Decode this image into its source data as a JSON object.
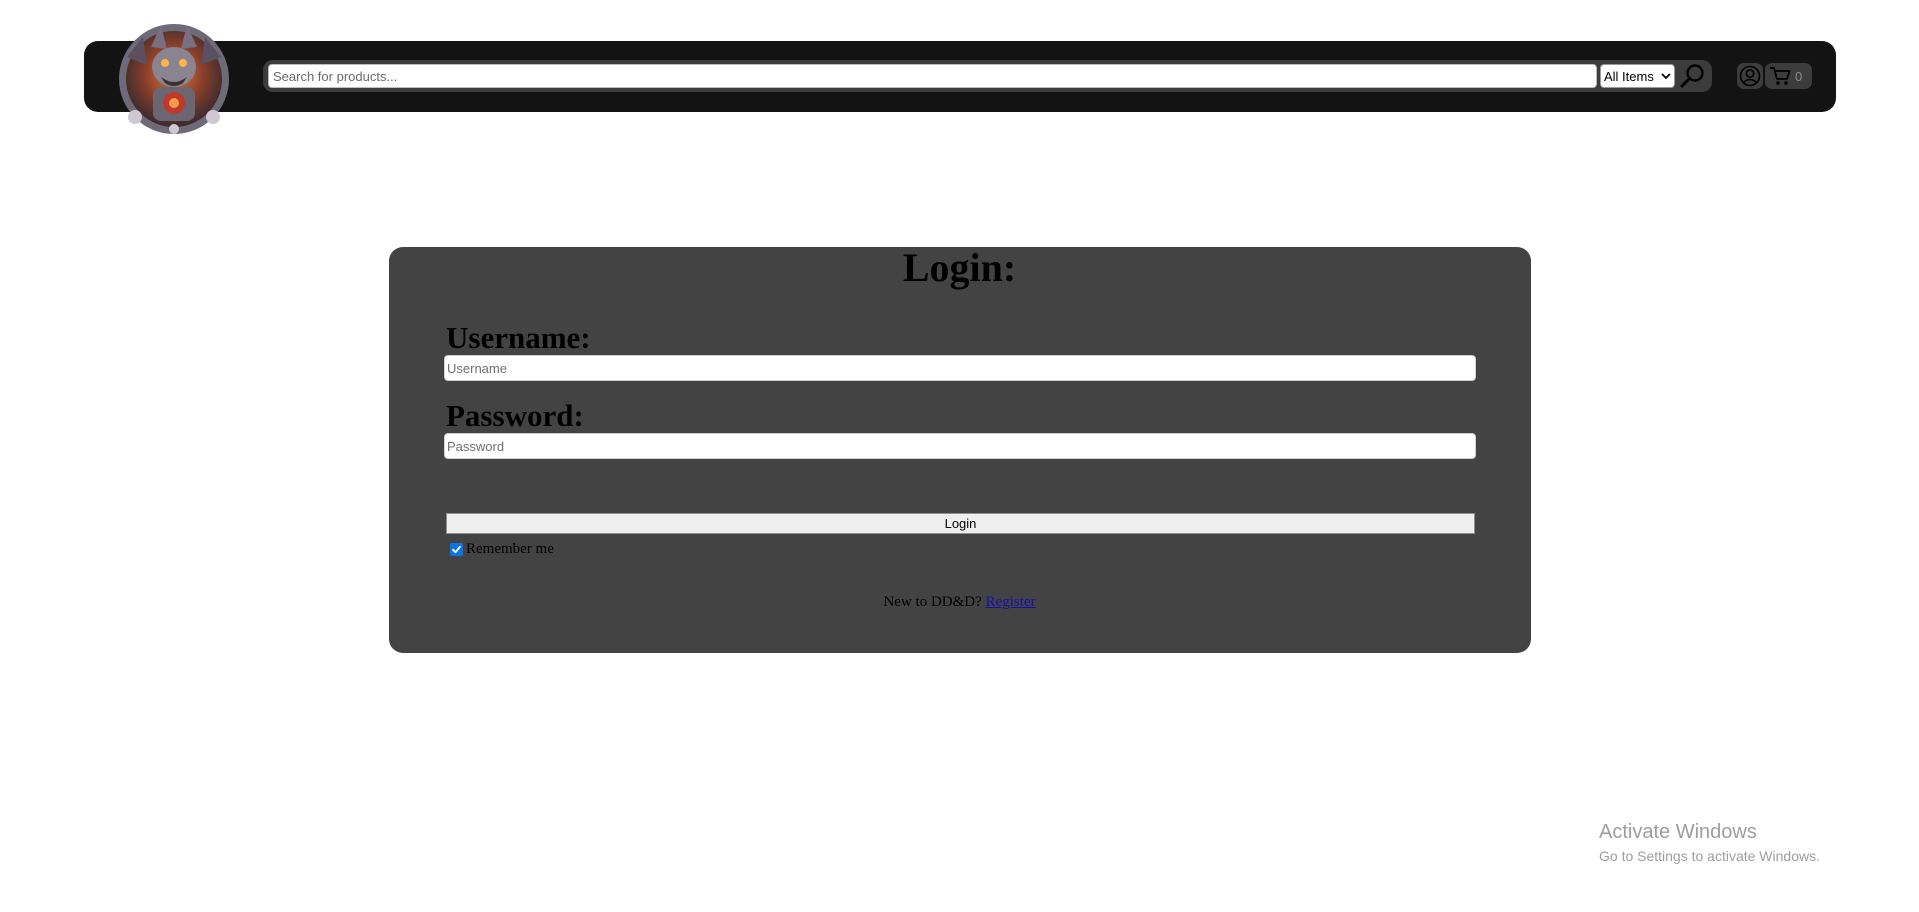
{
  "header": {
    "logo": "dragon-crest-logo",
    "search": {
      "placeholder": "Search for products...",
      "value": ""
    },
    "category_select": {
      "selected": "All Items"
    },
    "icons": {
      "search": "magnifier-icon",
      "account": "user-circle-icon",
      "cart": "cart-icon"
    },
    "cart_count": "0"
  },
  "login": {
    "title": "Login:",
    "username_label": "Username:",
    "username_placeholder": "Username",
    "password_label": "Password:",
    "password_placeholder": "Password",
    "submit_label": "Login",
    "remember_label": "Remember me",
    "remember_checked": true,
    "register_prompt": "New to DD&D?",
    "register_link": "Register"
  },
  "watermark": {
    "title": "Activate Windows",
    "subtitle": "Go to Settings to activate Windows."
  },
  "colors": {
    "header_bg": "#131313",
    "card_bg": "#434343",
    "checkbox_accent": "#0b75e8",
    "link": "#1a0dab"
  }
}
